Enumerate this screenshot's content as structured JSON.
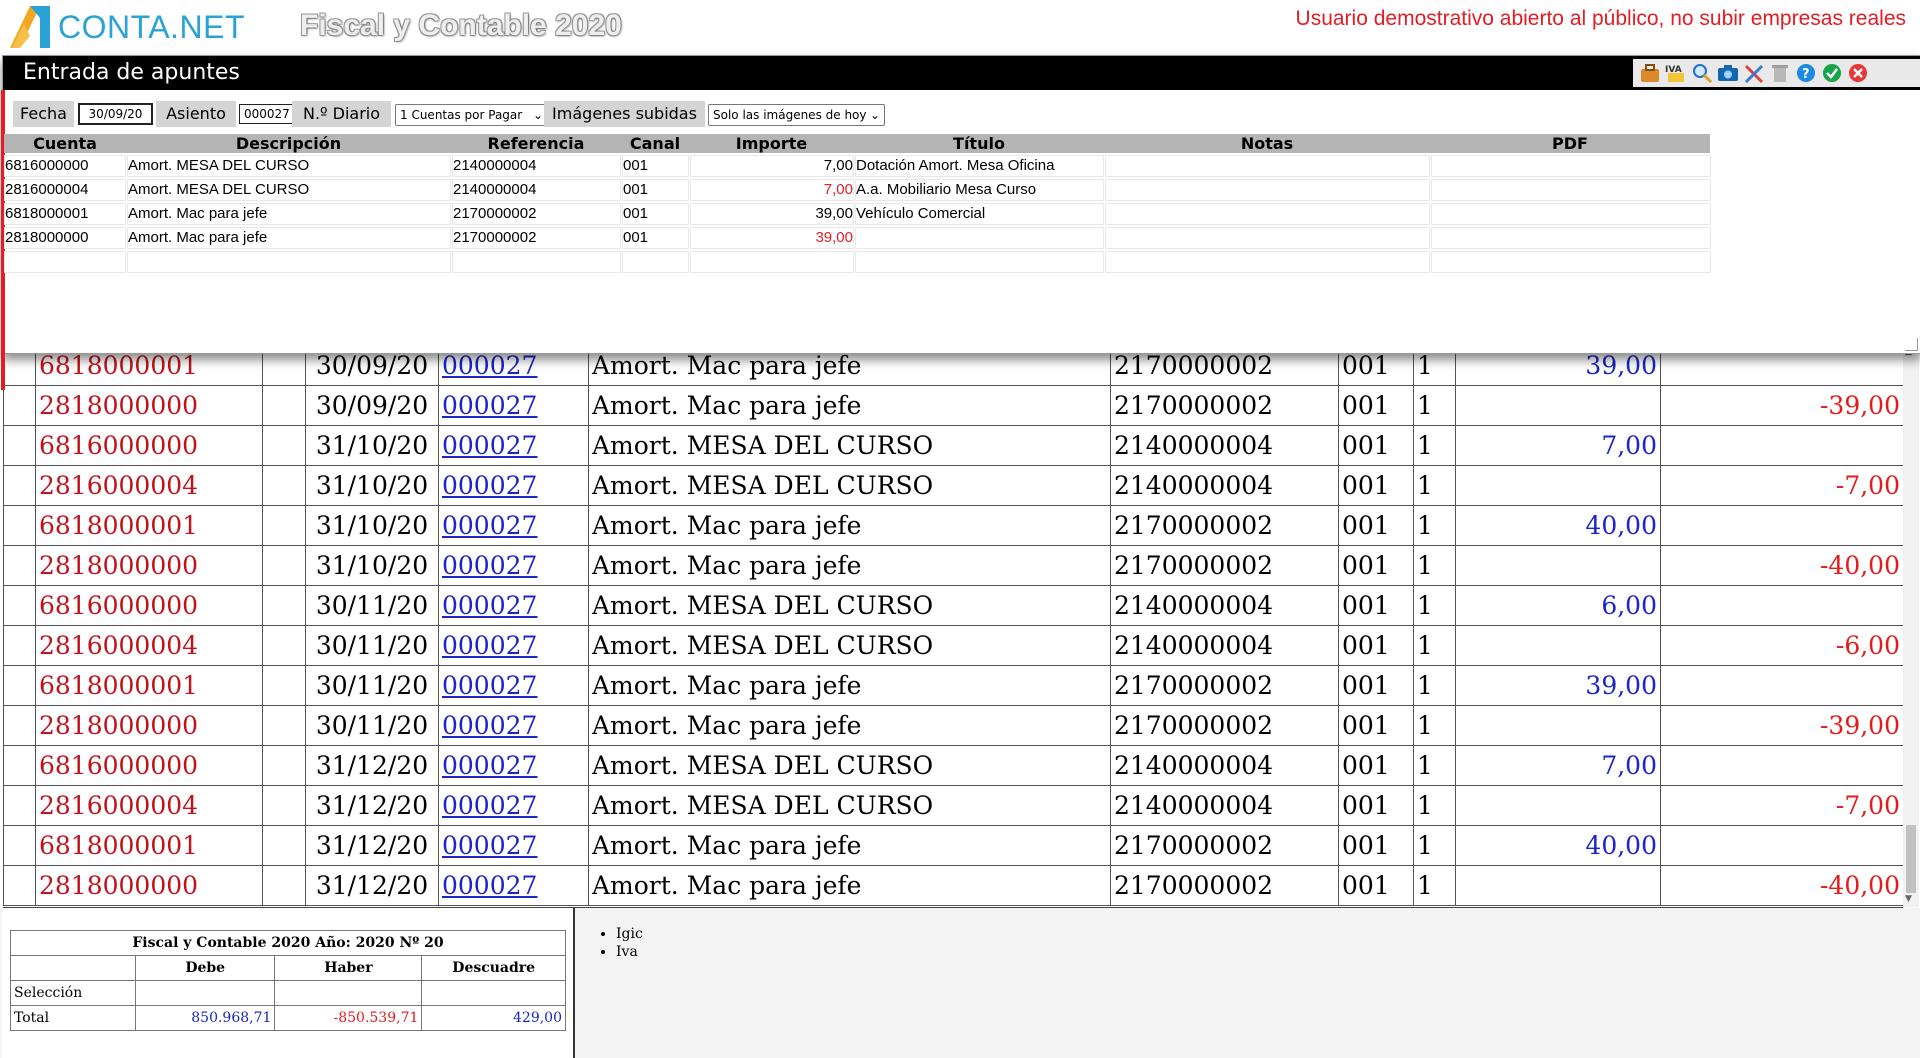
{
  "header": {
    "brand": "CONTA.NET",
    "app_title": "Fiscal y Contable 2020",
    "notice": "Usuario demostrativo abierto al público, no subir empresas reales"
  },
  "colors": {
    "accent_blue": "#2aa2d6",
    "notice_red": "#e21d24",
    "debe_blue": "#1b25c9",
    "haber_red": "#e31b1b"
  },
  "modal": {
    "title": "Entrada de apuntes",
    "toolbar_icons": [
      "briefcase-icon",
      "iva-icon",
      "search-icon",
      "camera-icon",
      "tools-icon",
      "trash-icon",
      "help-icon",
      "accept-icon",
      "close-icon"
    ],
    "form": {
      "fecha_label": "Fecha",
      "fecha_value": "30/09/20",
      "asiento_label": "Asiento",
      "asiento_value": "000027",
      "diario_label": "N.º Diario",
      "diario_selected": "1 Cuentas por Pagar",
      "imagenes_label": "Imágenes subidas",
      "imagenes_selected": "Solo las imágenes de hoy"
    },
    "columns": [
      "Cuenta",
      "Descripción",
      "Referencia",
      "Canal",
      "Importe",
      "Título",
      "Notas",
      "PDF"
    ],
    "rows": [
      {
        "cuenta": "6816000000",
        "descripcion": "Amort.  MESA DEL CURSO",
        "referencia": "2140000004",
        "canal": "001",
        "importe": "7,00",
        "importe_negative": false,
        "titulo": "Dotación Amort. Mesa Oficina",
        "notas": "",
        "pdf": ""
      },
      {
        "cuenta": "2816000004",
        "descripcion": "Amort.  MESA DEL CURSO",
        "referencia": "2140000004",
        "canal": "001",
        "importe": "7,00",
        "importe_negative": true,
        "titulo": "A.a. Mobiliario Mesa Curso",
        "notas": "",
        "pdf": ""
      },
      {
        "cuenta": "6818000001",
        "descripcion": "Amort.  Mac para jefe",
        "referencia": "2170000002",
        "canal": "001",
        "importe": "39,00",
        "importe_negative": false,
        "titulo": "Vehículo Comercial",
        "notas": "",
        "pdf": ""
      },
      {
        "cuenta": "2818000000",
        "descripcion": "Amort.  Mac para jefe",
        "referencia": "2170000002",
        "canal": "001",
        "importe": "39,00",
        "importe_negative": true,
        "titulo": "",
        "notas": "",
        "pdf": ""
      },
      {
        "cuenta": "",
        "descripcion": "",
        "referencia": "",
        "canal": "",
        "importe": "",
        "importe_negative": false,
        "titulo": "",
        "notas": "",
        "pdf": ""
      }
    ]
  },
  "ledger": {
    "rows": [
      {
        "cuenta": "6818000001",
        "fecha": "30/09/20",
        "asiento": "000027",
        "descripcion": "Amort.  Mac para jefe",
        "referencia": "2170000002",
        "canal": "001",
        "diario": "1",
        "debe": "39,00",
        "haber": ""
      },
      {
        "cuenta": "2818000000",
        "fecha": "30/09/20",
        "asiento": "000027",
        "descripcion": "Amort.  Mac para jefe",
        "referencia": "2170000002",
        "canal": "001",
        "diario": "1",
        "debe": "",
        "haber": "-39,00"
      },
      {
        "cuenta": "6816000000",
        "fecha": "31/10/20",
        "asiento": "000027",
        "descripcion": "Amort.  MESA DEL CURSO",
        "referencia": "2140000004",
        "canal": "001",
        "diario": "1",
        "debe": "7,00",
        "haber": ""
      },
      {
        "cuenta": "2816000004",
        "fecha": "31/10/20",
        "asiento": "000027",
        "descripcion": "Amort.  MESA DEL CURSO",
        "referencia": "2140000004",
        "canal": "001",
        "diario": "1",
        "debe": "",
        "haber": "-7,00"
      },
      {
        "cuenta": "6818000001",
        "fecha": "31/10/20",
        "asiento": "000027",
        "descripcion": "Amort.  Mac para jefe",
        "referencia": "2170000002",
        "canal": "001",
        "diario": "1",
        "debe": "40,00",
        "haber": ""
      },
      {
        "cuenta": "2818000000",
        "fecha": "31/10/20",
        "asiento": "000027",
        "descripcion": "Amort.  Mac para jefe",
        "referencia": "2170000002",
        "canal": "001",
        "diario": "1",
        "debe": "",
        "haber": "-40,00"
      },
      {
        "cuenta": "6816000000",
        "fecha": "30/11/20",
        "asiento": "000027",
        "descripcion": "Amort.  MESA DEL CURSO",
        "referencia": "2140000004",
        "canal": "001",
        "diario": "1",
        "debe": "6,00",
        "haber": ""
      },
      {
        "cuenta": "2816000004",
        "fecha": "30/11/20",
        "asiento": "000027",
        "descripcion": "Amort.  MESA DEL CURSO",
        "referencia": "2140000004",
        "canal": "001",
        "diario": "1",
        "debe": "",
        "haber": "-6,00"
      },
      {
        "cuenta": "6818000001",
        "fecha": "30/11/20",
        "asiento": "000027",
        "descripcion": "Amort.  Mac para jefe",
        "referencia": "2170000002",
        "canal": "001",
        "diario": "1",
        "debe": "39,00",
        "haber": ""
      },
      {
        "cuenta": "2818000000",
        "fecha": "30/11/20",
        "asiento": "000027",
        "descripcion": "Amort.  Mac para jefe",
        "referencia": "2170000002",
        "canal": "001",
        "diario": "1",
        "debe": "",
        "haber": "-39,00"
      },
      {
        "cuenta": "6816000000",
        "fecha": "31/12/20",
        "asiento": "000027",
        "descripcion": "Amort.  MESA DEL CURSO",
        "referencia": "2140000004",
        "canal": "001",
        "diario": "1",
        "debe": "7,00",
        "haber": ""
      },
      {
        "cuenta": "2816000004",
        "fecha": "31/12/20",
        "asiento": "000027",
        "descripcion": "Amort.  MESA DEL CURSO",
        "referencia": "2140000004",
        "canal": "001",
        "diario": "1",
        "debe": "",
        "haber": "-7,00"
      },
      {
        "cuenta": "6818000001",
        "fecha": "31/12/20",
        "asiento": "000027",
        "descripcion": "Amort.  Mac para jefe",
        "referencia": "2170000002",
        "canal": "001",
        "diario": "1",
        "debe": "40,00",
        "haber": ""
      },
      {
        "cuenta": "2818000000",
        "fecha": "31/12/20",
        "asiento": "000027",
        "descripcion": "Amort.  Mac para jefe",
        "referencia": "2170000002",
        "canal": "001",
        "diario": "1",
        "debe": "",
        "haber": "-40,00"
      }
    ]
  },
  "summary": {
    "caption": "Fiscal y Contable 2020 Año: 2020 Nº 20",
    "headers": [
      "Debe",
      "Haber",
      "Descuadre"
    ],
    "seleccion_label": "Selección",
    "total_label": "Total",
    "total_debe": "850.968,71",
    "total_haber": "-850.539,71",
    "total_descuadre": "429,00"
  },
  "tax_list": [
    "Igic",
    "Iva"
  ]
}
